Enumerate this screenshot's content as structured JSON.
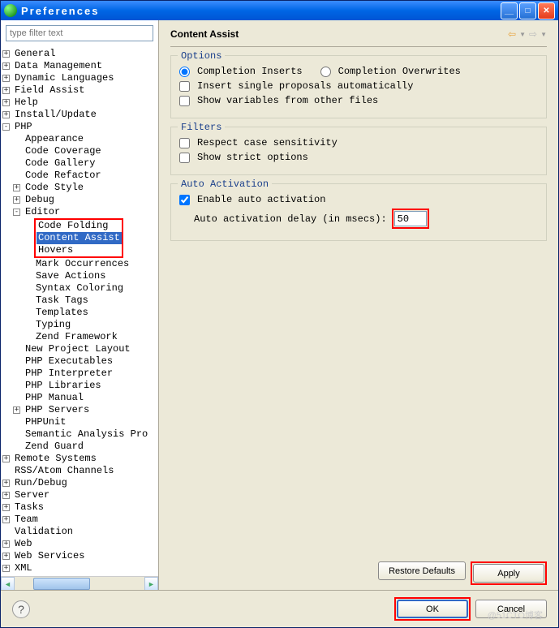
{
  "window": {
    "title": "Preferences"
  },
  "filter": {
    "placeholder": "type filter text"
  },
  "tree": [
    {
      "l": 0,
      "t": "+",
      "label": "General"
    },
    {
      "l": 0,
      "t": "+",
      "label": "Data Management"
    },
    {
      "l": 0,
      "t": "+",
      "label": "Dynamic Languages"
    },
    {
      "l": 0,
      "t": "+",
      "label": "Field Assist"
    },
    {
      "l": 0,
      "t": "+",
      "label": "Help"
    },
    {
      "l": 0,
      "t": "+",
      "label": "Install/Update"
    },
    {
      "l": 0,
      "t": "-",
      "label": "PHP"
    },
    {
      "l": 1,
      "t": " ",
      "label": "Appearance"
    },
    {
      "l": 1,
      "t": " ",
      "label": "Code Coverage"
    },
    {
      "l": 1,
      "t": " ",
      "label": "Code Gallery"
    },
    {
      "l": 1,
      "t": " ",
      "label": "Code Refactor"
    },
    {
      "l": 1,
      "t": "+",
      "label": "Code Style"
    },
    {
      "l": 1,
      "t": "+",
      "label": "Debug"
    },
    {
      "l": 1,
      "t": "-",
      "label": "Editor"
    },
    {
      "l": 2,
      "t": " ",
      "label": "Code Folding",
      "hlbox": true
    },
    {
      "l": 2,
      "t": " ",
      "label": "Content Assist",
      "selected": true,
      "hlbox": true
    },
    {
      "l": 2,
      "t": " ",
      "label": "Hovers",
      "hlbox": true
    },
    {
      "l": 2,
      "t": " ",
      "label": "Mark Occurrences"
    },
    {
      "l": 2,
      "t": " ",
      "label": "Save Actions"
    },
    {
      "l": 2,
      "t": " ",
      "label": "Syntax Coloring"
    },
    {
      "l": 2,
      "t": " ",
      "label": "Task Tags"
    },
    {
      "l": 2,
      "t": " ",
      "label": "Templates"
    },
    {
      "l": 2,
      "t": " ",
      "label": "Typing"
    },
    {
      "l": 2,
      "t": " ",
      "label": "Zend Framework"
    },
    {
      "l": 1,
      "t": " ",
      "label": "New Project Layout"
    },
    {
      "l": 1,
      "t": " ",
      "label": "PHP Executables"
    },
    {
      "l": 1,
      "t": " ",
      "label": "PHP Interpreter"
    },
    {
      "l": 1,
      "t": " ",
      "label": "PHP Libraries"
    },
    {
      "l": 1,
      "t": " ",
      "label": "PHP Manual"
    },
    {
      "l": 1,
      "t": "+",
      "label": "PHP Servers"
    },
    {
      "l": 1,
      "t": " ",
      "label": "PHPUnit"
    },
    {
      "l": 1,
      "t": " ",
      "label": "Semantic Analysis Pro"
    },
    {
      "l": 1,
      "t": " ",
      "label": "Zend Guard"
    },
    {
      "l": 0,
      "t": "+",
      "label": "Remote Systems"
    },
    {
      "l": 0,
      "t": " ",
      "label": "RSS/Atom Channels"
    },
    {
      "l": 0,
      "t": "+",
      "label": "Run/Debug"
    },
    {
      "l": 0,
      "t": "+",
      "label": "Server"
    },
    {
      "l": 0,
      "t": "+",
      "label": "Tasks"
    },
    {
      "l": 0,
      "t": "+",
      "label": "Team"
    },
    {
      "l": 0,
      "t": " ",
      "label": "Validation"
    },
    {
      "l": 0,
      "t": "+",
      "label": "Web"
    },
    {
      "l": 0,
      "t": "+",
      "label": "Web Services"
    },
    {
      "l": 0,
      "t": "+",
      "label": "XML"
    }
  ],
  "page": {
    "title": "Content Assist"
  },
  "options": {
    "legend": "Options",
    "radio_inserts": "Completion Inserts",
    "radio_overwrites": "Completion Overwrites",
    "chk_single": "Insert single proposals automatically",
    "chk_vars": "Show variables from other files",
    "radio_value": "inserts",
    "chk_single_val": false,
    "chk_vars_val": false
  },
  "filters": {
    "legend": "Filters",
    "chk_case": "Respect case sensitivity",
    "chk_strict": "Show strict options",
    "chk_case_val": false,
    "chk_strict_val": false
  },
  "auto": {
    "legend": "Auto Activation",
    "chk_enable": "Enable auto activation",
    "chk_enable_val": true,
    "delay_label": "Auto activation delay (in msecs):",
    "delay_value": "50"
  },
  "buttons": {
    "restore": "Restore Defaults",
    "apply": "Apply",
    "ok": "OK",
    "cancel": "Cancel"
  },
  "watermark": "@51CTO博客"
}
